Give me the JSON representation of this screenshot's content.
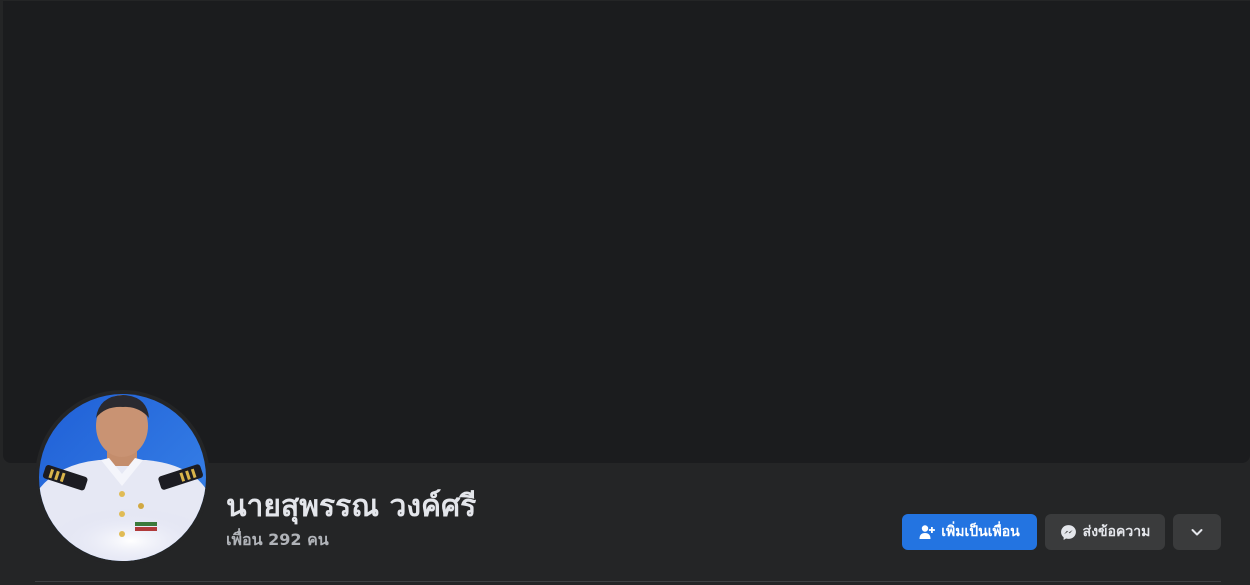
{
  "profile": {
    "name": "นายสุพรรณ วงค์ศรี",
    "friends_text": "เพื่อน 292 คน"
  },
  "actions": {
    "add_friend_label": "เพิ่มเป็นเพื่อน",
    "message_label": "ส่งข้อความ",
    "more_icon": "chevron-down-icon"
  },
  "icons": {
    "add_friend": "person-plus-icon",
    "message": "messenger-icon"
  },
  "colors": {
    "page_background": "#242526",
    "cover_background": "#1b1c1e",
    "primary_button": "#2374e1",
    "secondary_button": "#3a3b3c",
    "primary_text": "#e4e6eb",
    "secondary_text": "#b0b3b8"
  }
}
